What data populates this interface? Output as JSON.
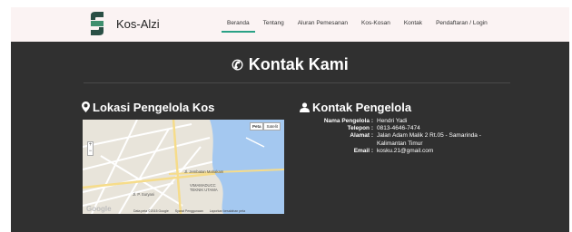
{
  "brand": {
    "name": "Kos-Alzi",
    "logo": "kos-alzi-logo"
  },
  "nav": {
    "items": [
      {
        "label": "Beranda",
        "active": true
      },
      {
        "label": "Tentang",
        "active": false
      },
      {
        "label": "Aluran Pemesanan",
        "active": false
      },
      {
        "label": "Kos-Kosan",
        "active": false
      },
      {
        "label": "Kontak",
        "active": false
      },
      {
        "label": "Pendaftaran / Login",
        "active": false
      }
    ]
  },
  "page": {
    "title": "Kontak Kami",
    "title_icon": "phone-icon"
  },
  "location": {
    "heading": "Lokasi Pengelola Kos",
    "heading_icon": "map-marker-icon",
    "map": {
      "type_buttons": [
        "Peta",
        "Satelit"
      ],
      "labels": {
        "road": "Jl. Jembatan Mahakam",
        "place": "VIMAMADUCC TEKNIK UTAMA",
        "street": "Jl. P. Suryani"
      },
      "footer": [
        "Data peta ©2015 Google",
        "Syarat Penggunaan",
        "Laporkan kesalahan peta"
      ],
      "logo": "Google"
    }
  },
  "contact": {
    "heading": "Kontak Pengelola",
    "heading_icon": "user-icon",
    "rows": [
      {
        "label": "Nama Pengelola :",
        "value": "Hendri Yadi"
      },
      {
        "label": "Telepon :",
        "value": "0813-4646-7474"
      },
      {
        "label": "Alamat :",
        "value": "Jalan Adam Malik 2 Rt.05 - Samarinda - Kalimantan Timur"
      },
      {
        "label": "Email :",
        "value": "kosku.21@gmail.com"
      }
    ]
  },
  "colors": {
    "accent": "#2aa186",
    "panel": "#303030",
    "navbar": "#fbf3f3",
    "water": "#a4c8f0"
  }
}
